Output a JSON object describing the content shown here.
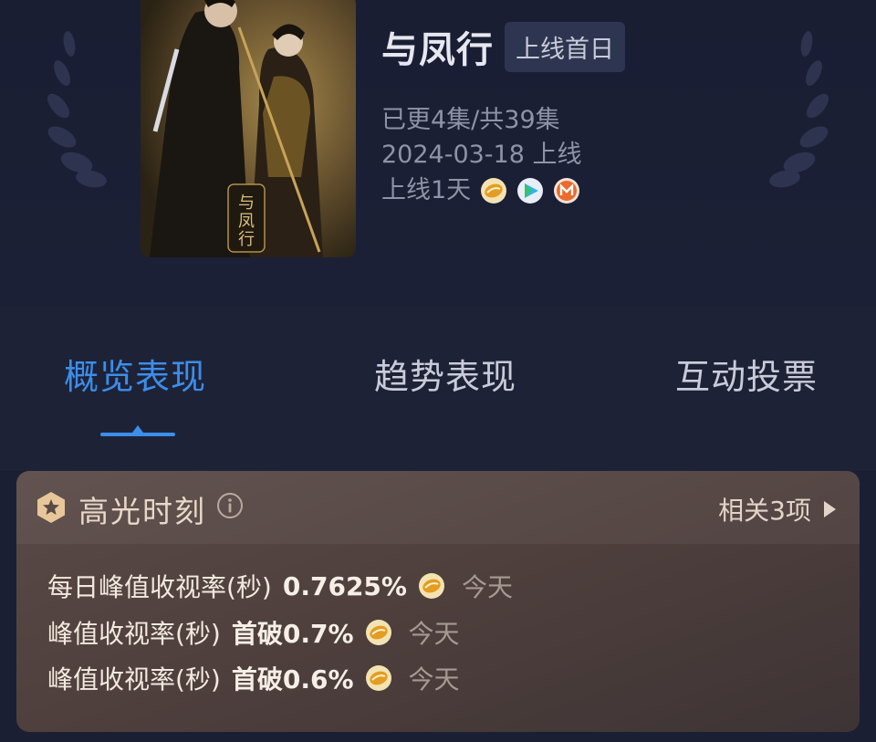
{
  "show": {
    "title": "与凤行",
    "status_badge": "上线首日",
    "episodes": "已更4集/共39集",
    "release": "2024-03-18 上线",
    "days_online": "上线1天",
    "poster_text": "与凤行",
    "platforms": [
      "mango-icon",
      "tencent-video-icon",
      "mgtv-icon"
    ]
  },
  "tabs": [
    {
      "label": "概览表现",
      "active": true
    },
    {
      "label": "趋势表现",
      "active": false
    },
    {
      "label": "互动投票",
      "active": false
    }
  ],
  "highlights": {
    "title": "高光时刻",
    "related": "相关3项",
    "items": [
      {
        "label": "每日峰值收视率(秒)",
        "value": "0.7625%",
        "day": "今天"
      },
      {
        "label": "峰值收视率(秒)",
        "value": "首破0.7%",
        "day": "今天"
      },
      {
        "label": "峰值收视率(秒)",
        "value": "首破0.6%",
        "day": "今天"
      }
    ]
  },
  "colors": {
    "background": "#1b1f33",
    "accent": "#3b8eea",
    "card": "#5a4a47",
    "muted_text": "#8f93a6"
  }
}
